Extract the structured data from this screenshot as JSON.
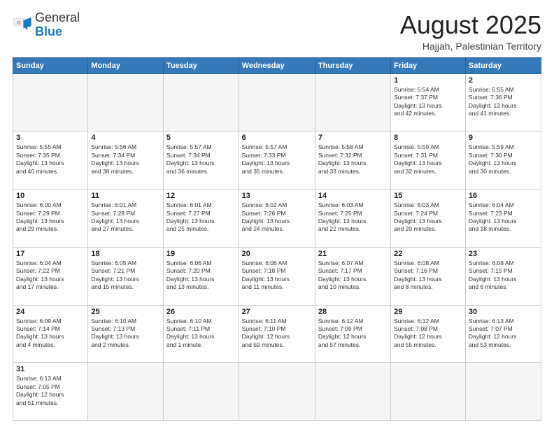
{
  "header": {
    "logo_general": "General",
    "logo_blue": "Blue",
    "title": "August 2025",
    "subtitle": "Hajjah, Palestinian Territory"
  },
  "weekdays": [
    "Sunday",
    "Monday",
    "Tuesday",
    "Wednesday",
    "Thursday",
    "Friday",
    "Saturday"
  ],
  "weeks": [
    [
      {
        "day": "",
        "info": ""
      },
      {
        "day": "",
        "info": ""
      },
      {
        "day": "",
        "info": ""
      },
      {
        "day": "",
        "info": ""
      },
      {
        "day": "",
        "info": ""
      },
      {
        "day": "1",
        "info": "Sunrise: 5:54 AM\nSunset: 7:37 PM\nDaylight: 13 hours\nand 42 minutes."
      },
      {
        "day": "2",
        "info": "Sunrise: 5:55 AM\nSunset: 7:36 PM\nDaylight: 13 hours\nand 41 minutes."
      }
    ],
    [
      {
        "day": "3",
        "info": "Sunrise: 5:55 AM\nSunset: 7:35 PM\nDaylight: 13 hours\nand 40 minutes."
      },
      {
        "day": "4",
        "info": "Sunrise: 5:56 AM\nSunset: 7:34 PM\nDaylight: 13 hours\nand 38 minutes."
      },
      {
        "day": "5",
        "info": "Sunrise: 5:57 AM\nSunset: 7:34 PM\nDaylight: 13 hours\nand 36 minutes."
      },
      {
        "day": "6",
        "info": "Sunrise: 5:57 AM\nSunset: 7:33 PM\nDaylight: 13 hours\nand 35 minutes."
      },
      {
        "day": "7",
        "info": "Sunrise: 5:58 AM\nSunset: 7:32 PM\nDaylight: 13 hours\nand 33 minutes."
      },
      {
        "day": "8",
        "info": "Sunrise: 5:59 AM\nSunset: 7:31 PM\nDaylight: 13 hours\nand 32 minutes."
      },
      {
        "day": "9",
        "info": "Sunrise: 5:59 AM\nSunset: 7:30 PM\nDaylight: 13 hours\nand 30 minutes."
      }
    ],
    [
      {
        "day": "10",
        "info": "Sunrise: 6:00 AM\nSunset: 7:29 PM\nDaylight: 13 hours\nand 29 minutes."
      },
      {
        "day": "11",
        "info": "Sunrise: 6:01 AM\nSunset: 7:28 PM\nDaylight: 13 hours\nand 27 minutes."
      },
      {
        "day": "12",
        "info": "Sunrise: 6:01 AM\nSunset: 7:27 PM\nDaylight: 13 hours\nand 25 minutes."
      },
      {
        "day": "13",
        "info": "Sunrise: 6:02 AM\nSunset: 7:26 PM\nDaylight: 13 hours\nand 24 minutes."
      },
      {
        "day": "14",
        "info": "Sunrise: 6:03 AM\nSunset: 7:25 PM\nDaylight: 13 hours\nand 22 minutes."
      },
      {
        "day": "15",
        "info": "Sunrise: 6:03 AM\nSunset: 7:24 PM\nDaylight: 13 hours\nand 20 minutes."
      },
      {
        "day": "16",
        "info": "Sunrise: 6:04 AM\nSunset: 7:23 PM\nDaylight: 13 hours\nand 18 minutes."
      }
    ],
    [
      {
        "day": "17",
        "info": "Sunrise: 6:04 AM\nSunset: 7:22 PM\nDaylight: 13 hours\nand 17 minutes."
      },
      {
        "day": "18",
        "info": "Sunrise: 6:05 AM\nSunset: 7:21 PM\nDaylight: 13 hours\nand 15 minutes."
      },
      {
        "day": "19",
        "info": "Sunrise: 6:06 AM\nSunset: 7:20 PM\nDaylight: 13 hours\nand 13 minutes."
      },
      {
        "day": "20",
        "info": "Sunrise: 6:06 AM\nSunset: 7:18 PM\nDaylight: 13 hours\nand 11 minutes."
      },
      {
        "day": "21",
        "info": "Sunrise: 6:07 AM\nSunset: 7:17 PM\nDaylight: 13 hours\nand 10 minutes."
      },
      {
        "day": "22",
        "info": "Sunrise: 6:08 AM\nSunset: 7:16 PM\nDaylight: 13 hours\nand 8 minutes."
      },
      {
        "day": "23",
        "info": "Sunrise: 6:08 AM\nSunset: 7:15 PM\nDaylight: 13 hours\nand 6 minutes."
      }
    ],
    [
      {
        "day": "24",
        "info": "Sunrise: 6:09 AM\nSunset: 7:14 PM\nDaylight: 13 hours\nand 4 minutes."
      },
      {
        "day": "25",
        "info": "Sunrise: 6:10 AM\nSunset: 7:13 PM\nDaylight: 13 hours\nand 2 minutes."
      },
      {
        "day": "26",
        "info": "Sunrise: 6:10 AM\nSunset: 7:11 PM\nDaylight: 13 hours\nand 1 minute."
      },
      {
        "day": "27",
        "info": "Sunrise: 6:11 AM\nSunset: 7:10 PM\nDaylight: 12 hours\nand 59 minutes."
      },
      {
        "day": "28",
        "info": "Sunrise: 6:12 AM\nSunset: 7:09 PM\nDaylight: 12 hours\nand 57 minutes."
      },
      {
        "day": "29",
        "info": "Sunrise: 6:12 AM\nSunset: 7:08 PM\nDaylight: 12 hours\nand 55 minutes."
      },
      {
        "day": "30",
        "info": "Sunrise: 6:13 AM\nSunset: 7:07 PM\nDaylight: 12 hours\nand 53 minutes."
      }
    ],
    [
      {
        "day": "31",
        "info": "Sunrise: 6:13 AM\nSunset: 7:05 PM\nDaylight: 12 hours\nand 51 minutes."
      },
      {
        "day": "",
        "info": ""
      },
      {
        "day": "",
        "info": ""
      },
      {
        "day": "",
        "info": ""
      },
      {
        "day": "",
        "info": ""
      },
      {
        "day": "",
        "info": ""
      },
      {
        "day": "",
        "info": ""
      }
    ]
  ]
}
